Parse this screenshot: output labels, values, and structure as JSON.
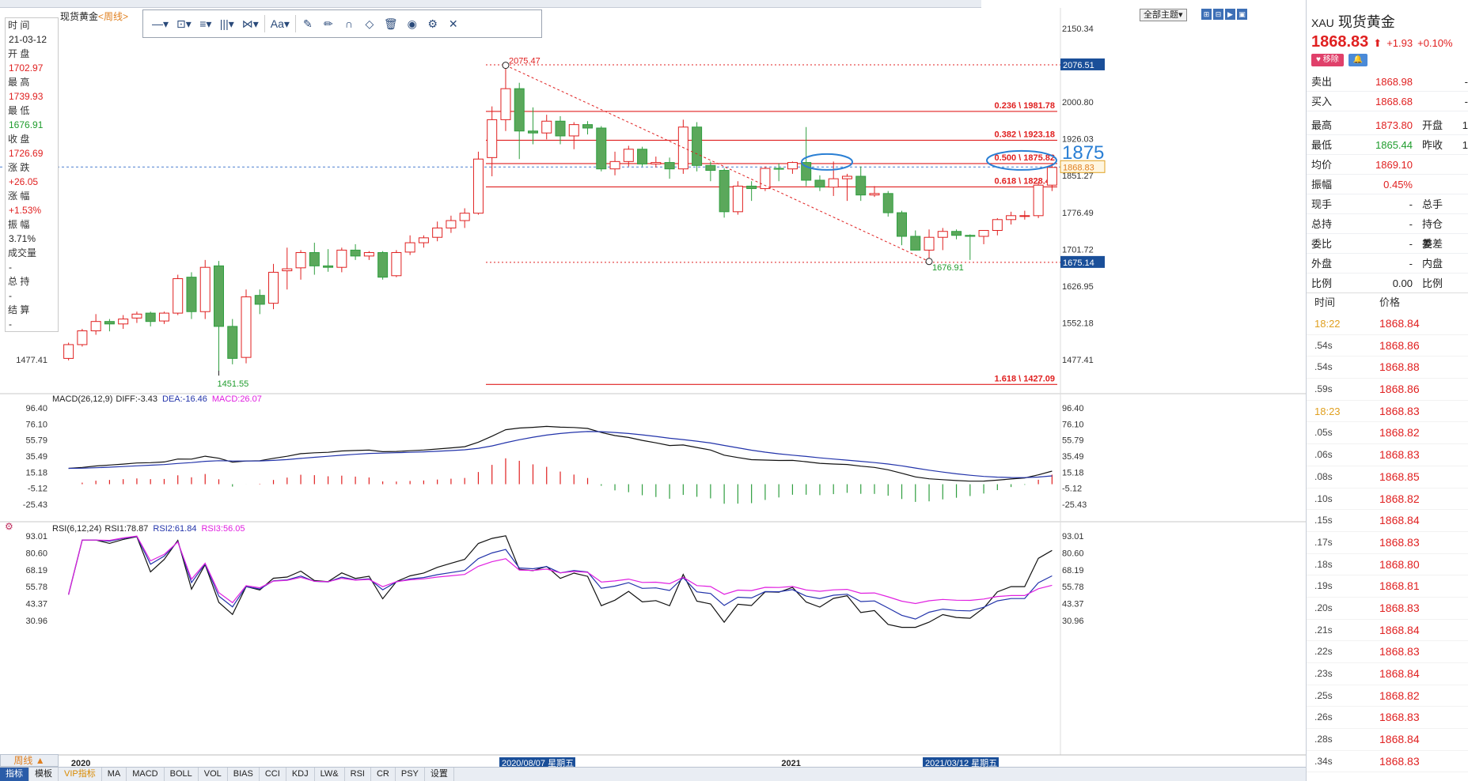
{
  "symbol_title": {
    "name": "现货黄金",
    "period": "<周线>"
  },
  "info_panel": [
    {
      "k": "时 间",
      "v": "21-03-12",
      "c": "black"
    },
    {
      "k": "开 盘",
      "v": "1702.97",
      "c": "red"
    },
    {
      "k": "最 高",
      "v": "1739.93",
      "c": "red"
    },
    {
      "k": "最 低",
      "v": "1676.91",
      "c": "green"
    },
    {
      "k": "收 盘",
      "v": "1726.69",
      "c": "red"
    },
    {
      "k": "涨 跌",
      "v": "+26.05",
      "c": "red"
    },
    {
      "k": "涨 幅",
      "v": "+1.53%",
      "c": "red"
    },
    {
      "k": "振 幅",
      "v": "3.71%",
      "c": "black"
    },
    {
      "k": "成交量",
      "v": "-",
      "c": "black"
    },
    {
      "k": "总 持",
      "v": "-",
      "c": "black"
    },
    {
      "k": "结 算",
      "v": "-",
      "c": "black"
    }
  ],
  "toolbar": {
    "items": [
      "—▾",
      "⊡▾",
      "≡▾",
      "|||▾",
      "⋈▾",
      "Aa▾",
      "✎",
      "✏",
      "∩",
      "◇",
      "🗑",
      "◉",
      "⚙",
      "✕"
    ]
  },
  "range_button": "全部主题▾",
  "range_icons": [
    "⊞",
    "⊟",
    "▶",
    "▣"
  ],
  "chart_data": {
    "type": "candlestick",
    "price_ticks": [
      "2150.34",
      "2076.51",
      "2000.80",
      "1926.03",
      "1851.27",
      "1776.49",
      "1701.72",
      "1626.95",
      "1552.18",
      "1477.41"
    ],
    "price_tick_values": [
      2150.34,
      2076.51,
      2000.8,
      1926.03,
      1851.27,
      1776.49,
      1701.72,
      1626.95,
      1552.18,
      1477.41
    ],
    "current_price_label": "1868.83",
    "high_label": "2076.51",
    "low_label": "1675.14",
    "annotations": {
      "high": "2075.47",
      "low1": "1451.55",
      "low2": "1676.91",
      "circle_text": "1875"
    },
    "fib_levels": [
      {
        "label": "0.236 \\ 1981.78",
        "value": 1981.78
      },
      {
        "label": "0.382 \\ 1923.18",
        "value": 1923.18
      },
      {
        "label": "0.500 \\ 1875.82",
        "value": 1875.82
      },
      {
        "label": "0.618 \\ 1828.46",
        "value": 1828.46
      },
      {
        "label": "1.618 \\ 1427.09",
        "value": 1427.09
      }
    ],
    "candles": [
      [
        1480,
        1512,
        1476,
        1508
      ],
      [
        1508,
        1540,
        1504,
        1536
      ],
      [
        1536,
        1570,
        1528,
        1555
      ],
      [
        1555,
        1560,
        1535,
        1550
      ],
      [
        1550,
        1568,
        1540,
        1560
      ],
      [
        1562,
        1575,
        1552,
        1570
      ],
      [
        1572,
        1575,
        1545,
        1555
      ],
      [
        1556,
        1575,
        1550,
        1572
      ],
      [
        1572,
        1650,
        1568,
        1642
      ],
      [
        1645,
        1655,
        1560,
        1575
      ],
      [
        1575,
        1680,
        1560,
        1665
      ],
      [
        1668,
        1678,
        1455,
        1545
      ],
      [
        1545,
        1560,
        1468,
        1480
      ],
      [
        1482,
        1620,
        1470,
        1605
      ],
      [
        1608,
        1620,
        1570,
        1590
      ],
      [
        1592,
        1672,
        1580,
        1655
      ],
      [
        1658,
        1705,
        1620,
        1662
      ],
      [
        1664,
        1700,
        1640,
        1695
      ],
      [
        1695,
        1715,
        1650,
        1668
      ],
      [
        1668,
        1702,
        1656,
        1665
      ],
      [
        1665,
        1705,
        1655,
        1700
      ],
      [
        1700,
        1712,
        1680,
        1688
      ],
      [
        1688,
        1698,
        1680,
        1695
      ],
      [
        1695,
        1698,
        1640,
        1645
      ],
      [
        1648,
        1700,
        1645,
        1695
      ],
      [
        1696,
        1730,
        1690,
        1715
      ],
      [
        1715,
        1730,
        1705,
        1725
      ],
      [
        1726,
        1758,
        1718,
        1745
      ],
      [
        1745,
        1770,
        1735,
        1760
      ],
      [
        1760,
        1785,
        1745,
        1775
      ],
      [
        1775,
        1900,
        1772,
        1885
      ],
      [
        1888,
        1992,
        1850,
        1965
      ],
      [
        1965,
        2075,
        1942,
        2028
      ],
      [
        2028,
        2040,
        1885,
        1942
      ],
      [
        1942,
        1990,
        1915,
        1938
      ],
      [
        1938,
        1975,
        1925,
        1962
      ],
      [
        1962,
        1972,
        1915,
        1932
      ],
      [
        1932,
        1960,
        1905,
        1955
      ],
      [
        1955,
        1962,
        1935,
        1948
      ],
      [
        1948,
        1952,
        1860,
        1865
      ],
      [
        1865,
        1900,
        1852,
        1880
      ],
      [
        1880,
        1912,
        1870,
        1905
      ],
      [
        1905,
        1910,
        1870,
        1875
      ],
      [
        1875,
        1890,
        1868,
        1878
      ],
      [
        1878,
        1888,
        1845,
        1865
      ],
      [
        1865,
        1965,
        1855,
        1950
      ],
      [
        1950,
        1960,
        1860,
        1872
      ],
      [
        1872,
        1880,
        1840,
        1862
      ],
      [
        1862,
        1866,
        1766,
        1778
      ],
      [
        1778,
        1840,
        1772,
        1830
      ],
      [
        1830,
        1840,
        1800,
        1825
      ],
      [
        1825,
        1870,
        1820,
        1866
      ],
      [
        1866,
        1876,
        1840,
        1865
      ],
      [
        1865,
        1880,
        1855,
        1878
      ],
      [
        1878,
        1950,
        1830,
        1842
      ],
      [
        1842,
        1852,
        1820,
        1828
      ],
      [
        1828,
        1880,
        1810,
        1845
      ],
      [
        1845,
        1855,
        1800,
        1850
      ],
      [
        1850,
        1870,
        1800,
        1812
      ],
      [
        1812,
        1830,
        1808,
        1815
      ],
      [
        1815,
        1820,
        1768,
        1776
      ],
      [
        1776,
        1780,
        1710,
        1728
      ],
      [
        1728,
        1740,
        1700,
        1700
      ],
      [
        1700,
        1742,
        1676,
        1726
      ],
      [
        1726,
        1745,
        1700,
        1738
      ],
      [
        1738,
        1742,
        1722,
        1730
      ],
      [
        1730,
        1732,
        1680,
        1728
      ],
      [
        1728,
        1740,
        1712,
        1740
      ],
      [
        1740,
        1765,
        1730,
        1762
      ],
      [
        1762,
        1778,
        1752,
        1770
      ],
      [
        1770,
        1780,
        1762,
        1770
      ],
      [
        1770,
        1838,
        1765,
        1832
      ],
      [
        1832,
        1875,
        1820,
        1868
      ]
    ],
    "macd": {
      "title": "MACD(26,12,9)",
      "diff": "DIFF:-3.43",
      "dea": "DEA:-16.46",
      "macd": "MACD:26.07",
      "ticks": [
        "96.40",
        "76.10",
        "55.79",
        "35.49",
        "15.18",
        "-5.12",
        "-25.43"
      ],
      "tick_values": [
        96.4,
        76.1,
        55.79,
        35.49,
        15.18,
        -5.12,
        -25.43
      ]
    },
    "rsi": {
      "title": "RSI(6,12,24)",
      "rsi1": "RSI1:78.87",
      "rsi2": "RSI2:61.84",
      "rsi3": "RSI3:56.05",
      "ticks": [
        "93.01",
        "80.60",
        "68.19",
        "55.78",
        "43.37",
        "30.96"
      ],
      "tick_values": [
        93.01,
        80.6,
        68.19,
        55.78,
        43.37,
        30.96
      ]
    },
    "x_labels": [
      {
        "text": "2020",
        "i": 1,
        "box": false
      },
      {
        "text": "2020/08/07 星期五",
        "i": 32,
        "box": true
      },
      {
        "text": "2021",
        "i": 53,
        "box": false
      },
      {
        "text": "2021/03/12 星期五",
        "i": 63,
        "box": true
      }
    ]
  },
  "period_tab": "周线 ▲",
  "bottom_tabs": [
    "指标",
    "模板",
    "VIP指标",
    "MA",
    "MACD",
    "BOLL",
    "VOL",
    "BIAS",
    "CCI",
    "KDJ",
    "LW&",
    "RSI",
    "CR",
    "PSY",
    "设置"
  ],
  "right_panel": {
    "code": "XAU",
    "name": "现货黄金",
    "price": "1868.83",
    "arrow": "⬆",
    "change": "+1.93",
    "change_pct": "+0.10%",
    "btn_remove": "♥ 移除",
    "btn_bell": "🔔",
    "rows_top": [
      {
        "c1": "卖出",
        "c2": "1868.98",
        "c3": "",
        "c4": "-"
      },
      {
        "c1": "买入",
        "c2": "1868.68",
        "c3": "",
        "c4": "-"
      }
    ],
    "rows_stats": [
      {
        "c1": "最高",
        "c2": "1873.80",
        "c3": "开盘",
        "c4": "1"
      },
      {
        "c1": "最低",
        "c2": "1865.44",
        "c3": "昨收",
        "c4": "1"
      },
      {
        "c1": "均价",
        "c2": "1869.10",
        "c3": "",
        "c4": ""
      },
      {
        "c1": "振幅",
        "c2": "0.45%",
        "c3": "",
        "c4": ""
      },
      {
        "c1": "现手",
        "c2": "-",
        "c3": "总手",
        "c4": ""
      },
      {
        "c1": "总持",
        "c2": "-",
        "c3": "持仓差",
        "c4": ""
      },
      {
        "c1": "委比",
        "c2": "-",
        "c3": "委差",
        "c4": ""
      },
      {
        "c1": "外盘",
        "c2": "-",
        "c3": "内盘",
        "c4": ""
      },
      {
        "c1": "比例",
        "c2": "0.00",
        "c3": "比例",
        "c4": ""
      }
    ],
    "tick_head": {
      "time": "时间",
      "price": "价格"
    },
    "ticks": [
      {
        "t": "18:22",
        "p": "1868.84",
        "hl": true
      },
      {
        "t": ".54s",
        "p": "1868.86",
        "hl": false
      },
      {
        "t": ".54s",
        "p": "1868.88",
        "hl": false
      },
      {
        "t": ".59s",
        "p": "1868.86",
        "hl": false
      },
      {
        "t": "18:23",
        "p": "1868.83",
        "hl": true
      },
      {
        "t": ".05s",
        "p": "1868.82",
        "hl": false
      },
      {
        "t": ".06s",
        "p": "1868.83",
        "hl": false
      },
      {
        "t": ".08s",
        "p": "1868.85",
        "hl": false
      },
      {
        "t": ".10s",
        "p": "1868.82",
        "hl": false
      },
      {
        "t": ".15s",
        "p": "1868.84",
        "hl": false
      },
      {
        "t": ".17s",
        "p": "1868.83",
        "hl": false
      },
      {
        "t": ".18s",
        "p": "1868.80",
        "hl": false
      },
      {
        "t": ".19s",
        "p": "1868.81",
        "hl": false
      },
      {
        "t": ".20s",
        "p": "1868.83",
        "hl": false
      },
      {
        "t": ".21s",
        "p": "1868.84",
        "hl": false
      },
      {
        "t": ".22s",
        "p": "1868.83",
        "hl": false
      },
      {
        "t": ".23s",
        "p": "1868.84",
        "hl": false
      },
      {
        "t": ".25s",
        "p": "1868.82",
        "hl": false
      },
      {
        "t": ".26s",
        "p": "1868.83",
        "hl": false
      },
      {
        "t": ".28s",
        "p": "1868.84",
        "hl": false
      },
      {
        "t": ".34s",
        "p": "1868.83",
        "hl": false
      }
    ]
  },
  "colors": {
    "up": "#e02020",
    "down": "#2f9e3f",
    "down_fill": "#5ba85b",
    "fib": "#e02020",
    "diff": "#111111",
    "dea": "#2233aa",
    "rsi3": "#e020e0"
  }
}
